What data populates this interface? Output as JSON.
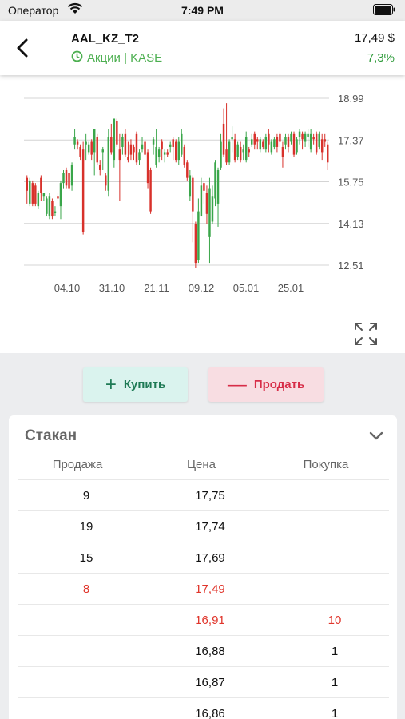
{
  "status_bar": {
    "carrier": "Оператор",
    "time": "7:49 PM"
  },
  "header": {
    "ticker": "AAL_KZ_T2",
    "market": "Акции | KASE",
    "price": "17,49 $",
    "change": "7,3%"
  },
  "chart_data": {
    "type": "candlestick",
    "y_ticks": [
      "18.99",
      "17.37",
      "15.75",
      "14.13",
      "12.51"
    ],
    "ylim": [
      12.51,
      18.99
    ],
    "x_ticks": [
      "04.10",
      "31.10",
      "21.11",
      "09.12",
      "05.01",
      "25.01"
    ],
    "colors": {
      "up": "#3aa64a",
      "down": "#d8312b"
    },
    "candles": [
      [
        15.9,
        15.4,
        16.0,
        14.9
      ],
      [
        14.9,
        15.8,
        15.9,
        14.8
      ],
      [
        15.7,
        14.9,
        15.8,
        14.8
      ],
      [
        15.6,
        14.9,
        15.7,
        14.8
      ],
      [
        14.8,
        15.3,
        15.4,
        14.7
      ],
      [
        15.9,
        15.3,
        16.0,
        15.0
      ],
      [
        15.2,
        15.3,
        15.3,
        15.0
      ],
      [
        14.5,
        15.1,
        15.2,
        14.4
      ],
      [
        14.4,
        15.2,
        15.3,
        14.3
      ],
      [
        15.0,
        14.4,
        15.1,
        14.3
      ],
      [
        14.6,
        14.6,
        14.8,
        14.4
      ],
      [
        15.2,
        15.1,
        15.3,
        15.0
      ],
      [
        14.8,
        15.7,
        15.8,
        14.3
      ],
      [
        15.7,
        16.1,
        16.2,
        15.5
      ],
      [
        16.2,
        15.6,
        16.3,
        15.5
      ],
      [
        16.1,
        15.5,
        16.1,
        15.4
      ],
      [
        15.6,
        16.4,
        16.5,
        15.4
      ],
      [
        17.2,
        17.5,
        17.8,
        17.0
      ],
      [
        17.3,
        17.2,
        17.4,
        17.0
      ],
      [
        17.1,
        16.7,
        17.2,
        16.6
      ],
      [
        17.0,
        13.8,
        17.3,
        13.7
      ],
      [
        17.2,
        17.3,
        17.6,
        16.6
      ],
      [
        16.9,
        17.2,
        17.3,
        16.8
      ],
      [
        17.3,
        16.8,
        17.4,
        16.6
      ],
      [
        16.9,
        17.8,
        17.8,
        16.0
      ],
      [
        17.5,
        16.5,
        17.6,
        16.4
      ],
      [
        16.4,
        16.2,
        16.6,
        16.0
      ],
      [
        16.9,
        17.0,
        17.1,
        16.2
      ],
      [
        16.0,
        15.6,
        16.1,
        15.4
      ],
      [
        15.4,
        17.5,
        17.8,
        15.2
      ],
      [
        17.5,
        16.9,
        18.0,
        16.8
      ],
      [
        16.6,
        18.2,
        18.2,
        16.3
      ],
      [
        18.1,
        17.2,
        18.2,
        17.1
      ],
      [
        17.0,
        16.6,
        17.6,
        15.0
      ],
      [
        17.1,
        17.5,
        17.6,
        16.8
      ],
      [
        17.6,
        16.8,
        17.8,
        16.7
      ],
      [
        16.7,
        16.6,
        17.3,
        16.5
      ],
      [
        17.2,
        16.8,
        17.4,
        16.6
      ],
      [
        17.1,
        16.9,
        17.2,
        16.6
      ],
      [
        17.6,
        16.5,
        17.7,
        16.4
      ],
      [
        16.6,
        16.9,
        17.0,
        16.4
      ],
      [
        17.0,
        17.2,
        17.5,
        16.9
      ],
      [
        17.3,
        16.8,
        17.4,
        16.7
      ],
      [
        16.9,
        15.7,
        17.0,
        15.5
      ],
      [
        16.2,
        14.6,
        16.3,
        14.5
      ],
      [
        17.2,
        17.4,
        17.5,
        16.8
      ],
      [
        16.4,
        17.1,
        17.8,
        16.3
      ],
      [
        16.7,
        17.0,
        17.1,
        16.5
      ],
      [
        17.3,
        17.0,
        17.4,
        16.6
      ],
      [
        16.8,
        16.9,
        17.0,
        16.5
      ],
      [
        16.9,
        16.8,
        17.0,
        16.7
      ],
      [
        17.1,
        17.2,
        17.3,
        16.9
      ],
      [
        17.4,
        17.1,
        17.5,
        16.6
      ],
      [
        17.3,
        16.6,
        17.4,
        16.5
      ],
      [
        16.6,
        17.3,
        17.5,
        16.4
      ],
      [
        16.8,
        17.6,
        17.8,
        16.7
      ],
      [
        17.1,
        16.4,
        17.2,
        16.3
      ],
      [
        16.5,
        15.9,
        16.6,
        15.8
      ],
      [
        15.2,
        16.0,
        16.2,
        15.0
      ],
      [
        15.9,
        14.6,
        16.0,
        13.4
      ],
      [
        14.1,
        12.6,
        14.2,
        12.4
      ],
      [
        12.7,
        14.6,
        15.1,
        12.6
      ],
      [
        14.4,
        15.6,
        15.9,
        14.4
      ],
      [
        15.7,
        15.4,
        15.8,
        14.9
      ],
      [
        15.3,
        14.5,
        15.6,
        14.1
      ],
      [
        13.6,
        15.5,
        15.9,
        12.6
      ],
      [
        14.2,
        15.2,
        15.6,
        14.1
      ],
      [
        15.1,
        16.5,
        16.6,
        14.8
      ],
      [
        14.9,
        16.2,
        16.3,
        14.0
      ],
      [
        16.3,
        17.3,
        17.6,
        16.2
      ],
      [
        18.0,
        16.8,
        18.6,
        16.7
      ],
      [
        17.0,
        16.5,
        18.8,
        16.4
      ],
      [
        16.5,
        17.3,
        17.4,
        16.4
      ],
      [
        17.4,
        17.5,
        17.9,
        16.9
      ],
      [
        17.4,
        16.6,
        17.6,
        16.5
      ],
      [
        16.7,
        17.2,
        17.3,
        16.6
      ],
      [
        17.1,
        16.6,
        17.3,
        16.5
      ],
      [
        16.9,
        17.0,
        17.2,
        16.6
      ],
      [
        16.6,
        17.5,
        17.7,
        16.5
      ],
      [
        17.0,
        16.9,
        17.1,
        16.7
      ],
      [
        17.2,
        17.4,
        17.6,
        17.1
      ],
      [
        17.6,
        17.2,
        17.7,
        17.0
      ],
      [
        17.4,
        17.3,
        17.5,
        17.0
      ],
      [
        17.0,
        17.4,
        17.5,
        16.9
      ],
      [
        17.3,
        17.1,
        17.4,
        17.0
      ],
      [
        17.0,
        17.5,
        17.6,
        16.9
      ],
      [
        17.6,
        17.2,
        17.8,
        16.9
      ],
      [
        16.9,
        17.3,
        17.4,
        16.8
      ],
      [
        17.1,
        17.4,
        17.5,
        17.0
      ],
      [
        17.5,
        17.1,
        17.6,
        16.9
      ],
      [
        17.6,
        17.3,
        17.7,
        17.1
      ],
      [
        17.1,
        16.7,
        17.3,
        16.3
      ],
      [
        17.2,
        17.5,
        17.6,
        17.0
      ],
      [
        17.5,
        17.1,
        17.6,
        16.9
      ],
      [
        17.3,
        17.6,
        17.7,
        17.2
      ],
      [
        17.6,
        16.8,
        17.7,
        16.7
      ],
      [
        16.9,
        17.4,
        17.5,
        16.8
      ],
      [
        17.5,
        17.7,
        17.8,
        17.2
      ],
      [
        17.6,
        17.4,
        17.7,
        17.0
      ],
      [
        17.3,
        17.6,
        17.7,
        17.1
      ],
      [
        17.5,
        17.6,
        17.8,
        17.1
      ],
      [
        17.0,
        17.6,
        17.8,
        16.9
      ],
      [
        17.5,
        17.4,
        17.6,
        17.2
      ],
      [
        17.6,
        16.9,
        17.7,
        16.8
      ],
      [
        17.1,
        17.6,
        17.7,
        17.0
      ],
      [
        17.4,
        16.9,
        17.6,
        16.6
      ],
      [
        17.4,
        17.3,
        17.6,
        17.1
      ],
      [
        17.2,
        16.5,
        17.3,
        16.2
      ]
    ]
  },
  "actions": {
    "buy_label": "Купить",
    "sell_label": "Продать"
  },
  "orderbook": {
    "title": "Стакан",
    "columns": {
      "sell": "Продажа",
      "price": "Цена",
      "buy": "Покупка"
    },
    "rows": [
      {
        "sell": "9",
        "price": "17,75",
        "buy": "",
        "red": false
      },
      {
        "sell": "19",
        "price": "17,74",
        "buy": "",
        "red": false
      },
      {
        "sell": "15",
        "price": "17,69",
        "buy": "",
        "red": false
      },
      {
        "sell": "8",
        "price": "17,49",
        "buy": "",
        "red": true
      },
      {
        "sell": "",
        "price": "16,91",
        "buy": "10",
        "red": true
      },
      {
        "sell": "",
        "price": "16,88",
        "buy": "1",
        "red": false
      },
      {
        "sell": "",
        "price": "16,87",
        "buy": "1",
        "red": false
      },
      {
        "sell": "",
        "price": "16,86",
        "buy": "1",
        "red": false
      }
    ]
  }
}
